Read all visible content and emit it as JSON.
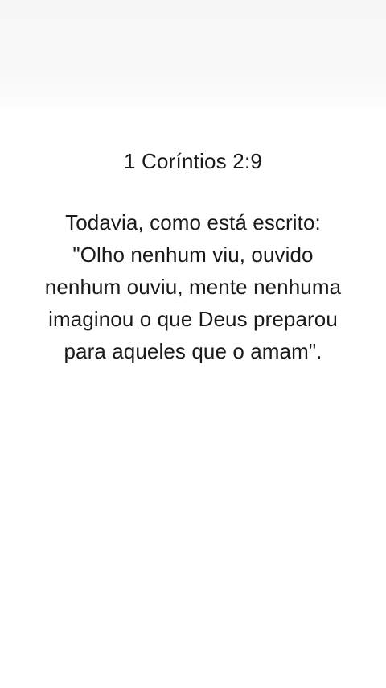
{
  "post": {
    "reference": "1 Coríntios 2:9",
    "verse_lines": [
      "Todavia, como está escrito:",
      "\"Olho nenhum viu, ouvido",
      "nenhum ouviu, mente nenhuma",
      "imaginou o que Deus preparou",
      "para aqueles que o amam\"."
    ]
  },
  "colors": {
    "background": "#ffffff",
    "top_band": "#f7f7f7",
    "text": "#1a1a1a"
  }
}
